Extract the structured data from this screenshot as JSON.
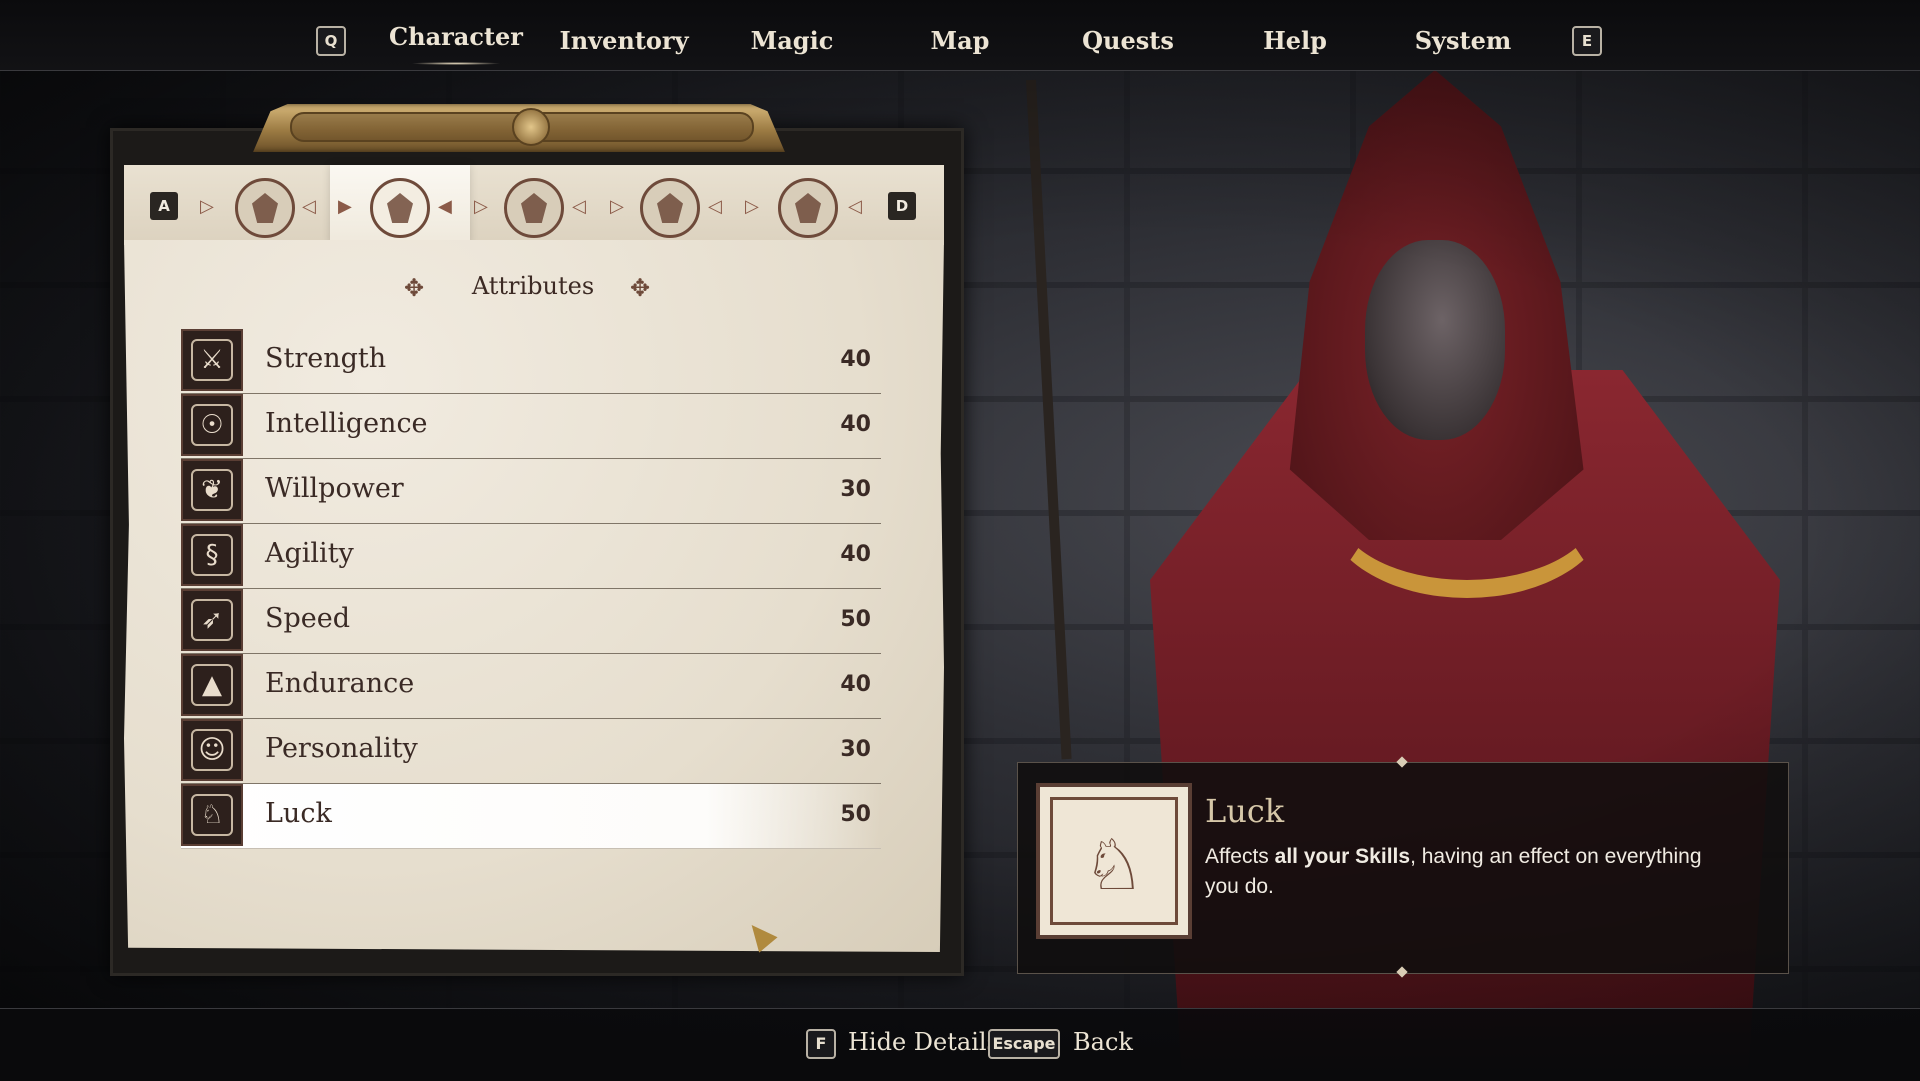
{
  "nav": {
    "left_key": "Q",
    "right_key": "E",
    "tabs": [
      "Character",
      "Inventory",
      "Magic",
      "Map",
      "Quests",
      "Help",
      "System"
    ],
    "active_tab": "Character"
  },
  "panel": {
    "left_key": "A",
    "right_key": "D",
    "tab_icons": [
      "fire-sigil-icon",
      "character-sigil-icon",
      "axe-sigil-icon",
      "crown-sigil-icon",
      "flower-sigil-icon"
    ],
    "active_tab_icon": "character-sigil-icon",
    "section_title": "Attributes",
    "attributes": [
      {
        "name": "Strength",
        "value": "40",
        "icon": "sword-icon",
        "glyph": "⚔"
      },
      {
        "name": "Intelligence",
        "value": "40",
        "icon": "brain-head-icon",
        "glyph": "☉"
      },
      {
        "name": "Willpower",
        "value": "30",
        "icon": "feather-icon",
        "glyph": "❦"
      },
      {
        "name": "Agility",
        "value": "40",
        "icon": "serpent-icon",
        "glyph": "§"
      },
      {
        "name": "Speed",
        "value": "50",
        "icon": "arrow-icon",
        "glyph": "➶"
      },
      {
        "name": "Endurance",
        "value": "40",
        "icon": "mountain-icon",
        "glyph": "▲"
      },
      {
        "name": "Personality",
        "value": "30",
        "icon": "mask-icon",
        "glyph": "☺"
      },
      {
        "name": "Luck",
        "value": "50",
        "icon": "unicorn-icon",
        "glyph": "♘"
      }
    ],
    "selected_attribute": "Luck"
  },
  "tooltip": {
    "title": "Luck",
    "desc_before": "Affects ",
    "desc_bold": "all your Skills",
    "desc_after": ", having an effect on everything you do.",
    "icon": "unicorn-icon",
    "glyph": "♘"
  },
  "footer": {
    "hide_key": "F",
    "hide_label": "Hide Details",
    "back_key": "Escape",
    "back_label": "Back"
  },
  "colors": {
    "parchment": "#e6dece",
    "ink": "#3a2a25",
    "accent_gold": "#c9953a",
    "robe_red": "#7a2228"
  }
}
